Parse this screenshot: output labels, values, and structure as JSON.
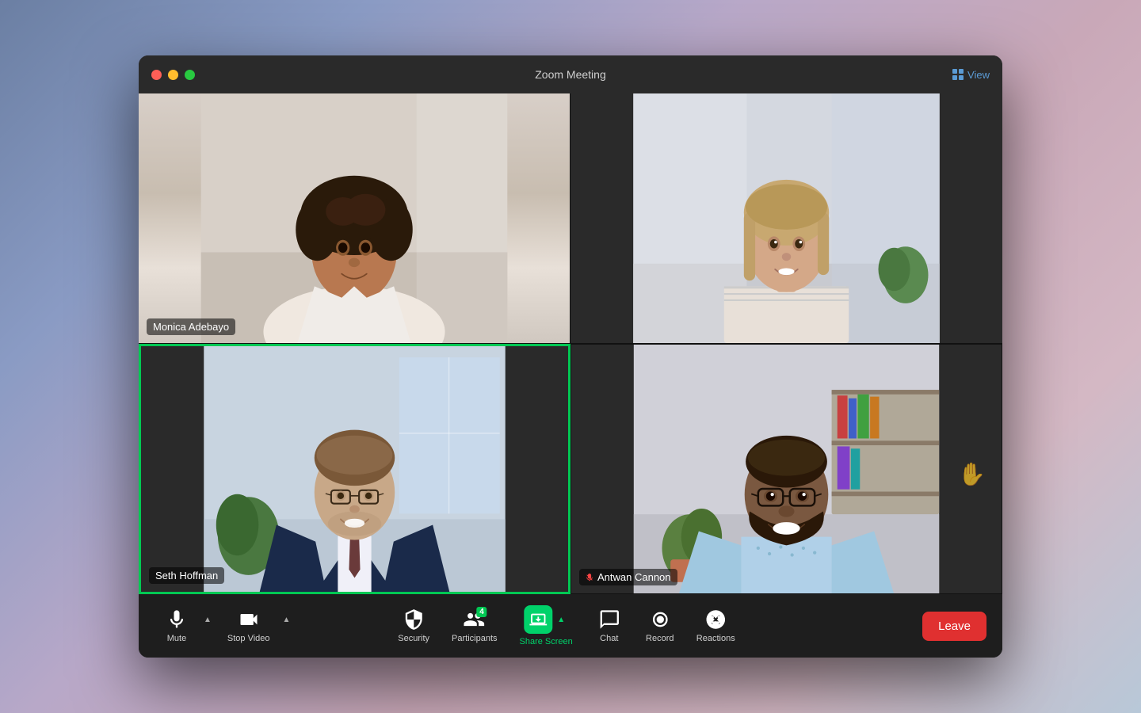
{
  "window": {
    "title": "Zoom Meeting",
    "view_label": "View"
  },
  "participants": [
    {
      "id": "monica",
      "name": "Monica Adebayo",
      "position": "top-left",
      "muted": false,
      "active_speaker": false
    },
    {
      "id": "woman2",
      "name": "",
      "position": "top-right",
      "muted": false,
      "active_speaker": false
    },
    {
      "id": "seth",
      "name": "Seth Hoffman",
      "position": "bottom-left",
      "muted": false,
      "active_speaker": true
    },
    {
      "id": "antwan",
      "name": "Antwan Cannon",
      "position": "bottom-right",
      "muted": true,
      "active_speaker": false,
      "reaction": "✋"
    }
  ],
  "toolbar": {
    "mute_label": "Mute",
    "stop_video_label": "Stop Video",
    "security_label": "Security",
    "participants_label": "Participants",
    "participants_count": "4",
    "share_screen_label": "Share Screen",
    "chat_label": "Chat",
    "record_label": "Record",
    "reactions_label": "Reactions",
    "leave_label": "Leave"
  },
  "colors": {
    "active_speaker_border": "#00c853",
    "share_screen_green": "#00d26a",
    "leave_red": "#e03030",
    "toolbar_bg": "#1e1e1e",
    "window_bg": "#1a1a1a"
  }
}
